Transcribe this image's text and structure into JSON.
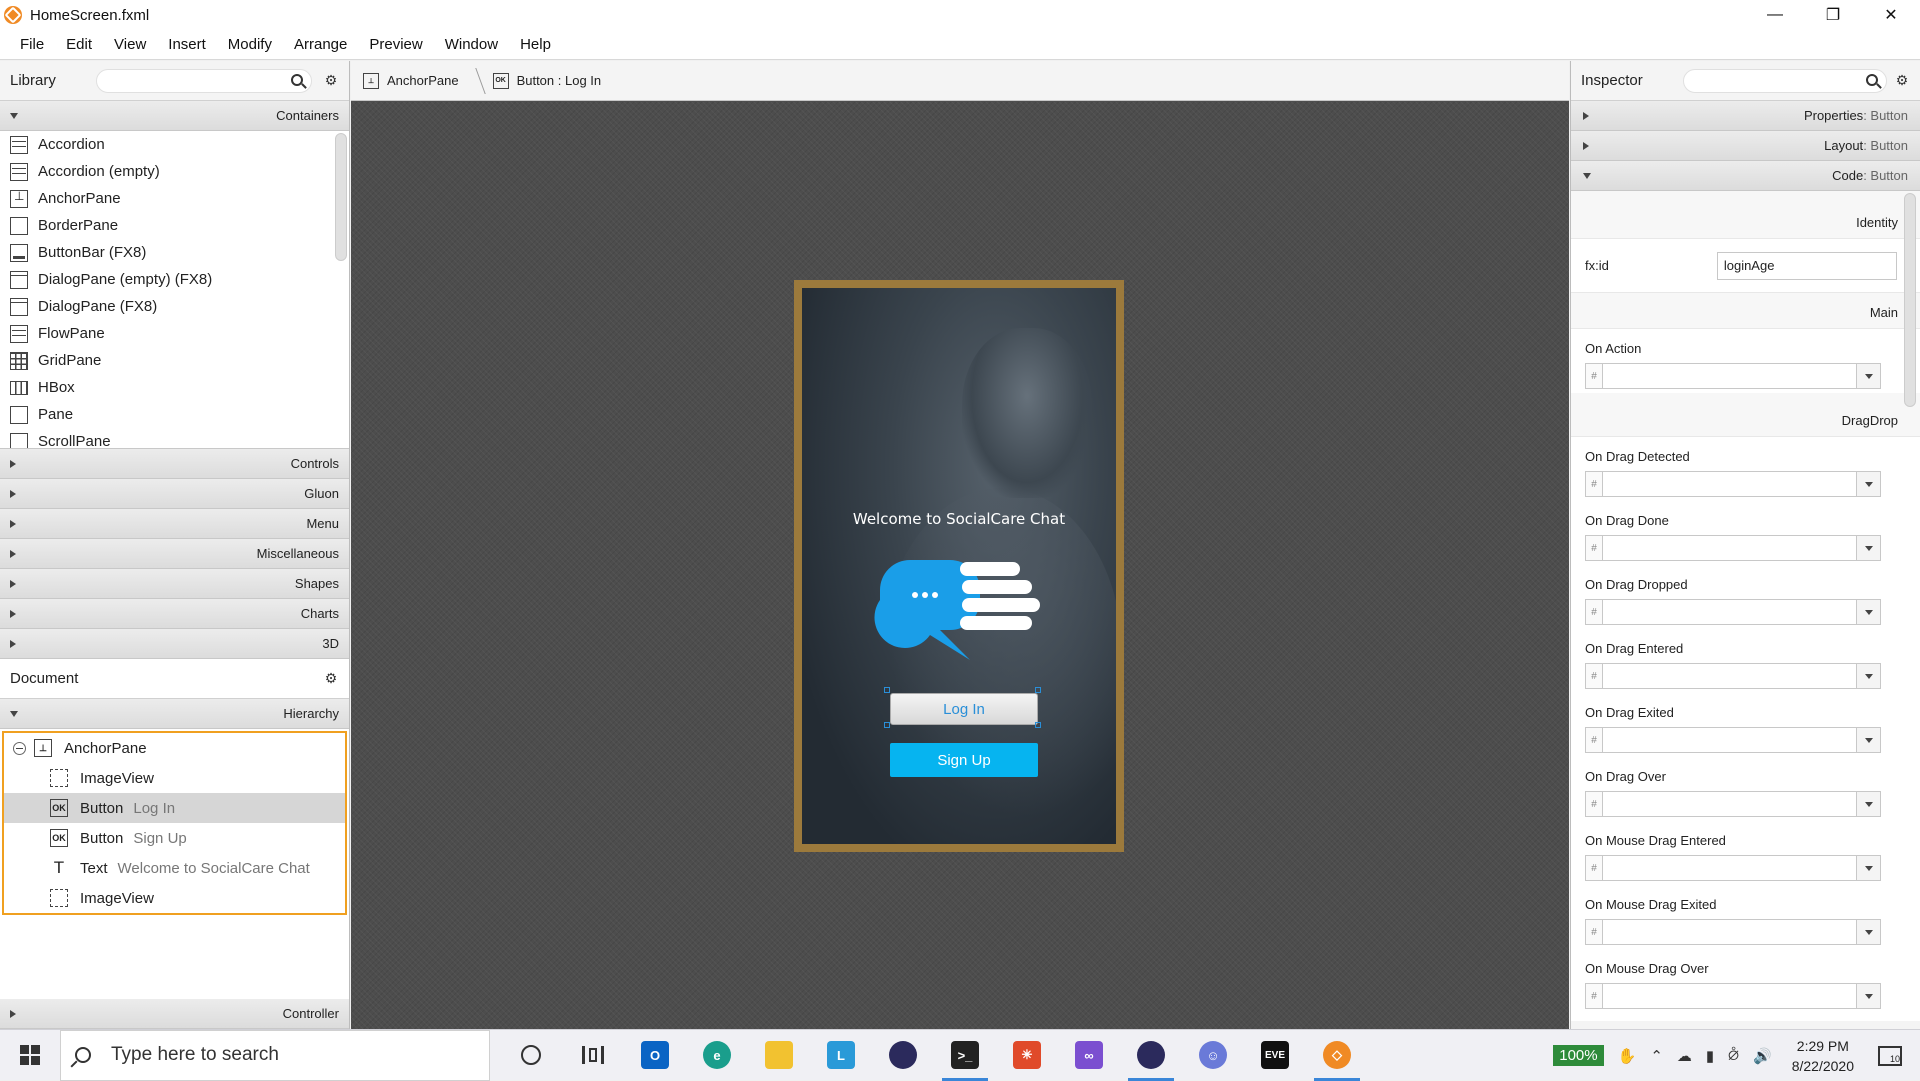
{
  "window": {
    "title": "HomeScreen.fxml"
  },
  "menu": [
    "File",
    "Edit",
    "View",
    "Insert",
    "Modify",
    "Arrange",
    "Preview",
    "Window",
    "Help"
  ],
  "library": {
    "title": "Library",
    "sections": {
      "containers": "Containers",
      "controls": "Controls",
      "gluon": "Gluon",
      "menu": "Menu",
      "misc": "Miscellaneous",
      "shapes": "Shapes",
      "charts": "Charts",
      "threed": "3D"
    },
    "items": [
      {
        "label": "Accordion",
        "icon": "accordion-icon"
      },
      {
        "label": "Accordion  (empty)",
        "icon": "accordion-icon"
      },
      {
        "label": "AnchorPane",
        "icon": "anchorpane-icon"
      },
      {
        "label": "BorderPane",
        "icon": "borderpane-icon"
      },
      {
        "label": "ButtonBar  (FX8)",
        "icon": "buttonbar-icon"
      },
      {
        "label": "DialogPane (empty)  (FX8)",
        "icon": "dialogpane-icon"
      },
      {
        "label": "DialogPane  (FX8)",
        "icon": "dialogpane-icon"
      },
      {
        "label": "FlowPane",
        "icon": "flowpane-icon"
      },
      {
        "label": "GridPane",
        "icon": "gridpane-icon"
      },
      {
        "label": "HBox",
        "icon": "hbox-icon"
      },
      {
        "label": "Pane",
        "icon": "pane-icon"
      },
      {
        "label": "ScrollPane",
        "icon": "scrollpane-icon"
      }
    ]
  },
  "document": {
    "title": "Document",
    "hierarchy_label": "Hierarchy",
    "controller_label": "Controller",
    "tree": [
      {
        "type": "AnchorPane",
        "sub": ""
      },
      {
        "type": "ImageView",
        "sub": ""
      },
      {
        "type": "Button",
        "sub": "Log In"
      },
      {
        "type": "Button",
        "sub": "Sign Up"
      },
      {
        "type": "Text",
        "sub": "Welcome to SocialCare Chat"
      },
      {
        "type": "ImageView",
        "sub": ""
      }
    ]
  },
  "breadcrumb": {
    "root": "AnchorPane",
    "current": "Button : Log In",
    "ok_badge": "OK"
  },
  "preview": {
    "welcome": "Welcome to SocialCare Chat",
    "login": "Log In",
    "signup": "Sign Up",
    "frame_color": "#9c7a3c",
    "accent": "#06b4f0"
  },
  "inspector": {
    "title": "Inspector",
    "properties": {
      "label": "Properties",
      "suffix": " : Button"
    },
    "layout": {
      "label": "Layout",
      "suffix": " : Button"
    },
    "code": {
      "label": "Code",
      "suffix": " : Button"
    },
    "identity": "Identity",
    "fxid_label": "fx:id",
    "fxid_value": "loginAge",
    "main": "Main",
    "on_action": "On Action",
    "dragdrop": "DragDrop",
    "events": [
      "On Drag Detected",
      "On Drag Done",
      "On Drag Dropped",
      "On Drag Entered",
      "On Drag Exited",
      "On Drag Over",
      "On Mouse Drag Entered",
      "On Mouse Drag Exited",
      "On Mouse Drag Over"
    ],
    "hash": "#"
  },
  "taskbar": {
    "search_placeholder": "Type here to search",
    "battery": "100%",
    "time": "2:29 PM",
    "date": "8/22/2020",
    "notifications": "10",
    "apps": [
      "cortana-icon",
      "task-view-icon",
      "outlook-icon",
      "edge-icon",
      "file-explorer-icon",
      "l-app-icon",
      "eclipse-icon",
      "terminal-icon",
      "app-red-icon",
      "visual-studio-icon",
      "eclipse-alt-icon",
      "discord-icon",
      "eve-icon",
      "scene-builder-icon"
    ]
  }
}
